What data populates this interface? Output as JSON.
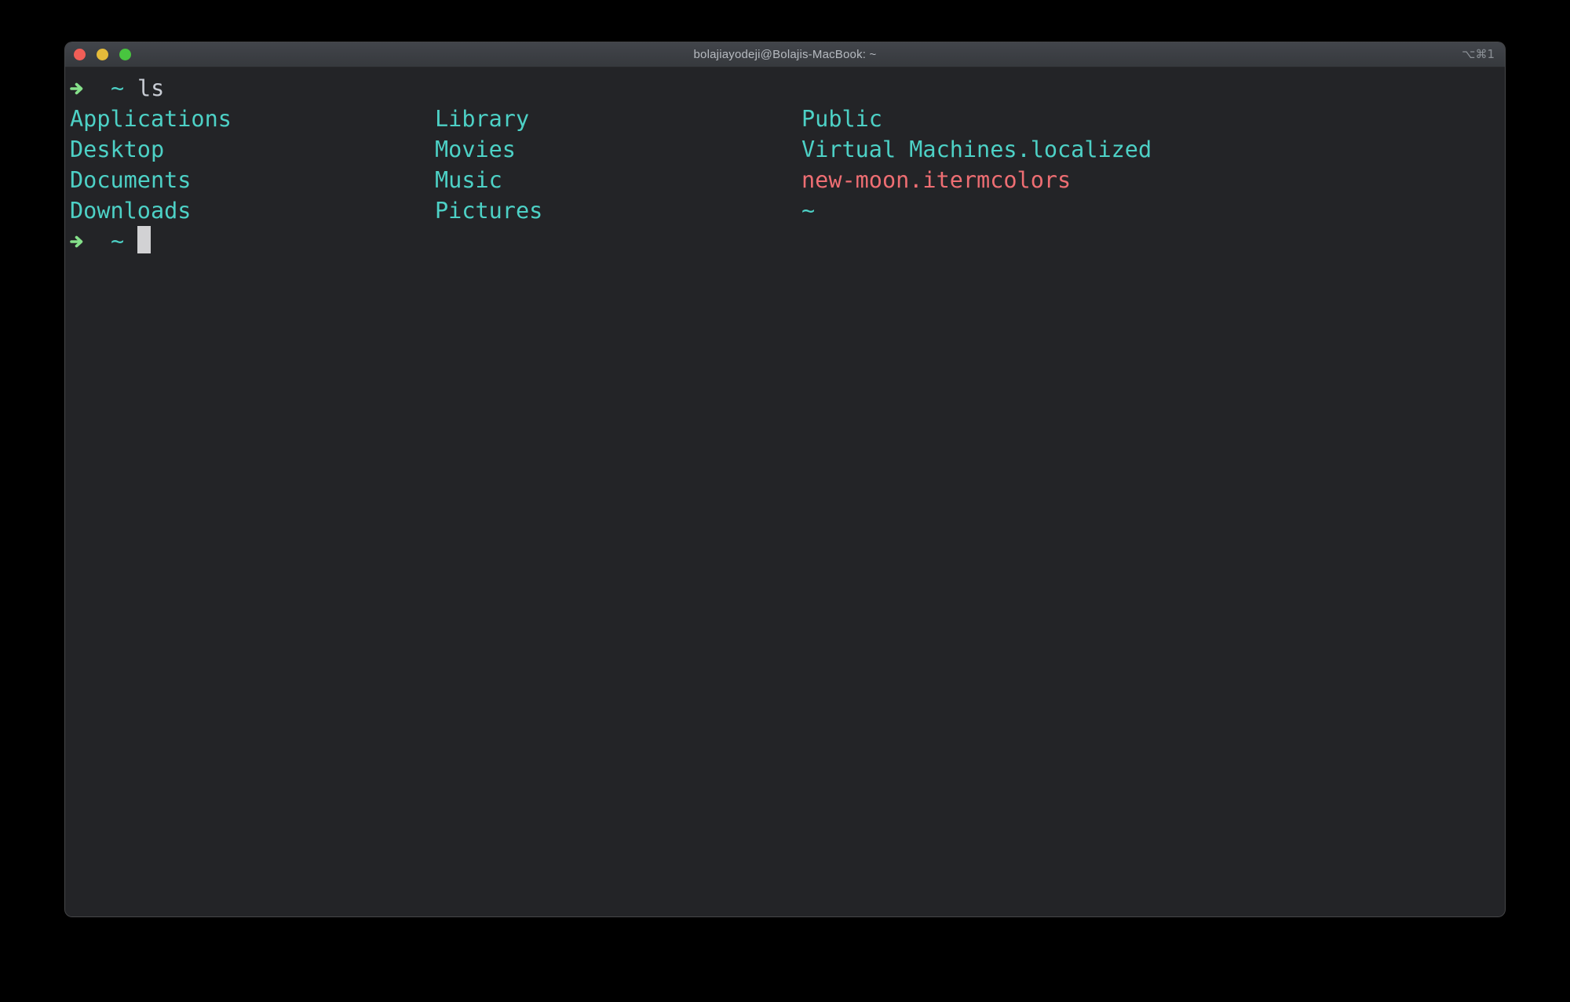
{
  "window": {
    "title": "bolajiayodeji@Bolajis-MacBook: ~",
    "shortcut_badge": "⌥⌘1",
    "controls": {
      "close_icon": "close-icon",
      "minimize_icon": "minimize-icon",
      "zoom_icon": "zoom-icon"
    }
  },
  "palette": {
    "desktop_background": "#000000",
    "terminal_background": "#232427",
    "titlebar_background": "#3b3e43",
    "titlebar_text": "#b6bac0",
    "cyan": "#4dd1c6",
    "red": "#ee6e73",
    "green": "#85e08a",
    "foreground": "#c8ccd4",
    "cursor": "#d2d2d4"
  },
  "terminal": {
    "prompt1": {
      "arrow_icon": "arrow-right-icon",
      "path": "~",
      "command": "ls"
    },
    "listing_rows": [
      {
        "col0": {
          "text": "Applications",
          "color": "cyan"
        },
        "col1": {
          "text": "Library",
          "color": "cyan"
        },
        "col2": {
          "text": "Public",
          "color": "cyan"
        }
      },
      {
        "col0": {
          "text": "Desktop",
          "color": "cyan"
        },
        "col1": {
          "text": "Movies",
          "color": "cyan"
        },
        "col2": {
          "text": "Virtual Machines.localized",
          "color": "cyan"
        }
      },
      {
        "col0": {
          "text": "Documents",
          "color": "cyan"
        },
        "col1": {
          "text": "Music",
          "color": "cyan"
        },
        "col2": {
          "text": "new-moon.itermcolors",
          "color": "red"
        }
      },
      {
        "col0": {
          "text": "Downloads",
          "color": "cyan"
        },
        "col1": {
          "text": "Pictures",
          "color": "cyan"
        },
        "col2": {
          "text": "~",
          "color": "cyan"
        }
      }
    ],
    "prompt2": {
      "arrow_icon": "arrow-right-icon",
      "path": "~",
      "cursor_style": "block"
    }
  }
}
